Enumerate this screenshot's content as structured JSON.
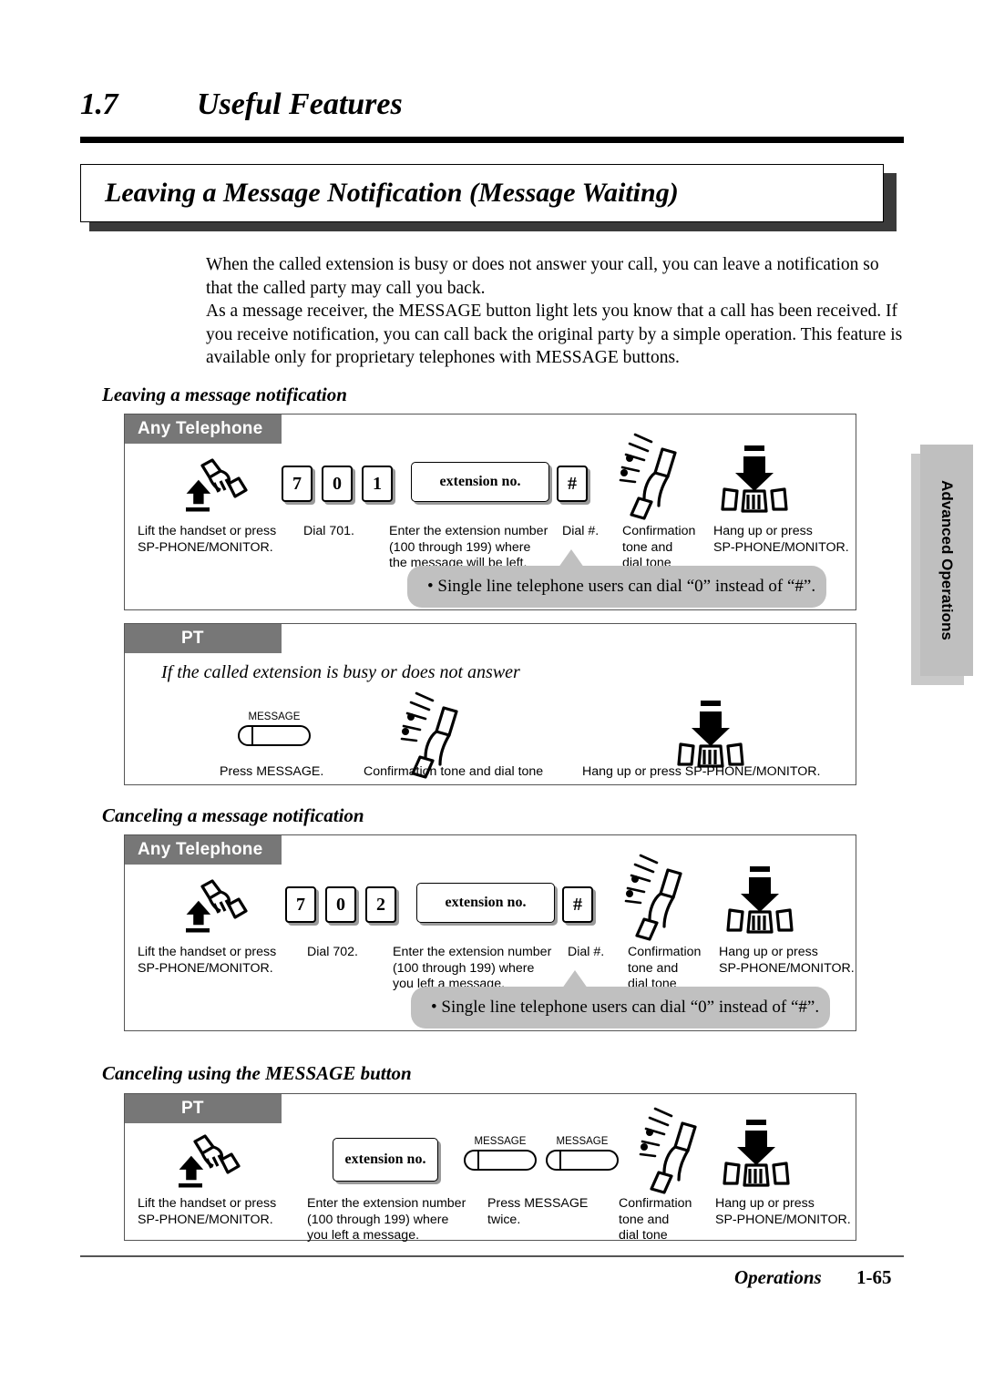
{
  "section": {
    "number": "1.7",
    "title": "Useful Features"
  },
  "feature_title": "Leaving a Message Notification (Message Waiting)",
  "intro": {
    "p1": "When the called extension is busy or does not answer your call, you can leave a notification so that the called party may call you back.",
    "p2": "As a message receiver, the MESSAGE button light lets you know that a call has been received. If you receive notification, you can call back the original party by a simple operation. This feature is available only for proprietary telephones with MESSAGE buttons."
  },
  "side_tab": "Advanced Operations",
  "subheads": {
    "leaving": "Leaving a message notification",
    "canceling": "Canceling a message notification",
    "canceling_msg": "Canceling using the MESSAGE button"
  },
  "tags": {
    "any_telephone": "Any Telephone",
    "pt": "PT"
  },
  "note_bubble": "•  Single line telephone users can dial “0” instead of “#”.",
  "box1": {
    "tag": "Any Telephone",
    "keys": [
      "7",
      "0",
      "1"
    ],
    "plate": "extension no.",
    "hash_key": "#",
    "captions": {
      "lift": "Lift the handset or press\nSP-PHONE/MONITOR.",
      "dial": "Dial 701.",
      "enter": "Enter the extension number\n(100 through 199) where\nthe message will be left.",
      "hash": "Dial #.",
      "confirm": "Confirmation\ntone and\ndial tone",
      "hangup": "Hang up or press\nSP-PHONE/MONITOR."
    }
  },
  "box2": {
    "tag": "PT",
    "condition": "If the called extension is busy or does not answer",
    "message_label": "MESSAGE",
    "captions": {
      "press": "Press MESSAGE.",
      "confirm": "Confirmation tone and dial tone",
      "hangup": "Hang up or press SP-PHONE/MONITOR."
    }
  },
  "box3": {
    "tag": "Any Telephone",
    "keys": [
      "7",
      "0",
      "2"
    ],
    "plate": "extension no.",
    "hash_key": "#",
    "captions": {
      "lift": "Lift the handset or press\nSP-PHONE/MONITOR.",
      "dial": "Dial 702.",
      "enter": "Enter the extension number\n(100 through 199) where\nyou left a message.",
      "hash": "Dial #.",
      "confirm": "Confirmation\ntone and\ndial tone",
      "hangup": "Hang up or press\nSP-PHONE/MONITOR."
    }
  },
  "box4": {
    "tag": "PT",
    "plate": "extension no.",
    "message_label_1": "MESSAGE",
    "message_label_2": "MESSAGE",
    "captions": {
      "lift": "Lift the handset or press\nSP-PHONE/MONITOR.",
      "enter": "Enter the extension number\n(100 through 199) where\nyou left a message.",
      "press": "Press MESSAGE\ntwice.",
      "confirm": "Confirmation\ntone and\ndial tone",
      "hangup": "Hang up or press\nSP-PHONE/MONITOR."
    }
  },
  "footer": {
    "label": "Operations",
    "page": "1-65"
  },
  "colors": {
    "tag_gray": "#777777",
    "bubble_gray": "#c0c0c0",
    "side_tab_gray": "#bfbfbf"
  }
}
